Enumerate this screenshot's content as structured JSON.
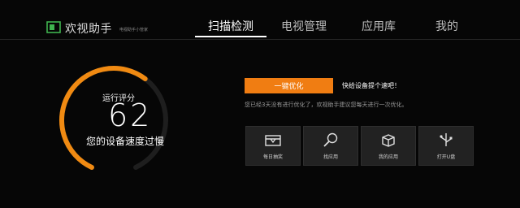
{
  "header": {
    "app_name": "欢视助手",
    "app_subtitle": "电视助手小管家",
    "logo_icon": "tv-screen-icon"
  },
  "nav": {
    "items": [
      {
        "label": "扫描检测",
        "active": true
      },
      {
        "label": "电视管理",
        "active": false
      },
      {
        "label": "应用库",
        "active": false
      },
      {
        "label": "我的",
        "active": false
      }
    ]
  },
  "score": {
    "title": "运行评分",
    "value": "62",
    "fraction": 0.62,
    "status": "您的设备速度过慢"
  },
  "optimize": {
    "button_label": "一键优化",
    "tip": "快给设备提个速吧！",
    "hint": "您已经3天没有进行优化了，欢视助手建议您每天进行一次优化。"
  },
  "tiles": [
    {
      "label": "每日抽奖",
      "icon": "gift-box-icon"
    },
    {
      "label": "找应用",
      "icon": "search-icon"
    },
    {
      "label": "我的应用",
      "icon": "package-box-icon"
    },
    {
      "label": "打开U盘",
      "icon": "usb-icon"
    }
  ],
  "colors": {
    "accent": "#f07d12",
    "background": "#060606",
    "tile": "#222222"
  }
}
